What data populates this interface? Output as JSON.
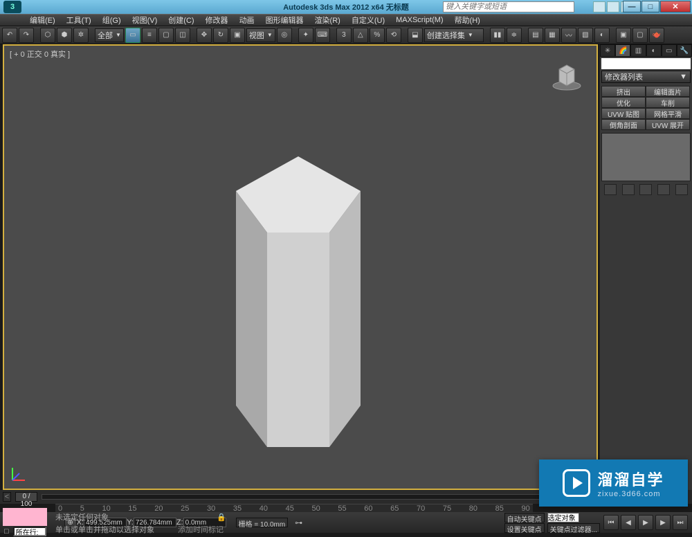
{
  "title": "Autodesk 3ds Max  2012 x64     无标题",
  "keyword_placeholder": "键入关键字或短语",
  "menus": [
    "编辑(E)",
    "工具(T)",
    "组(G)",
    "视图(V)",
    "创建(C)",
    "修改器",
    "动画",
    "图形编辑器",
    "渲染(R)",
    "自定义(U)",
    "MAXScript(M)",
    "帮助(H)"
  ],
  "toolbar": {
    "all": "全部",
    "viewport": "视图",
    "selset": "创建选择集"
  },
  "viewport_label": "[ + 0 正交 0 真实 ]",
  "modpanel": {
    "list_label": "修改器列表",
    "buttons": [
      "挤出",
      "编辑面片",
      "优化",
      "车削",
      "UVW 贴图",
      "网格平滑",
      "倒角剖面",
      "UVW 展开"
    ]
  },
  "timeline": {
    "frame": "0 / 100",
    "ticks": [
      "0",
      "5",
      "10",
      "15",
      "20",
      "25",
      "30",
      "35",
      "40",
      "45",
      "50",
      "55",
      "60",
      "65",
      "70",
      "75",
      "80",
      "85",
      "90"
    ]
  },
  "status": {
    "row_label": "所在行:",
    "no_sel": "未选定任何对象",
    "hint": "单击或单击并拖动以选择对象",
    "add_marker": "添加时间标记",
    "xl": "X:",
    "xv": "499.525mm",
    "yl": "Y:",
    "yv": "726.784mm",
    "zl": "Z:",
    "zv": "0.0mm",
    "grid": "栅格 = 10.0mm",
    "autokey": "自动关键点",
    "selset": "选定对象",
    "setkey": "设置关键点",
    "keyfilter": "关键点过滤器..."
  },
  "watermark": {
    "big": "溜溜自学",
    "small": "zixue.3d66.com"
  }
}
